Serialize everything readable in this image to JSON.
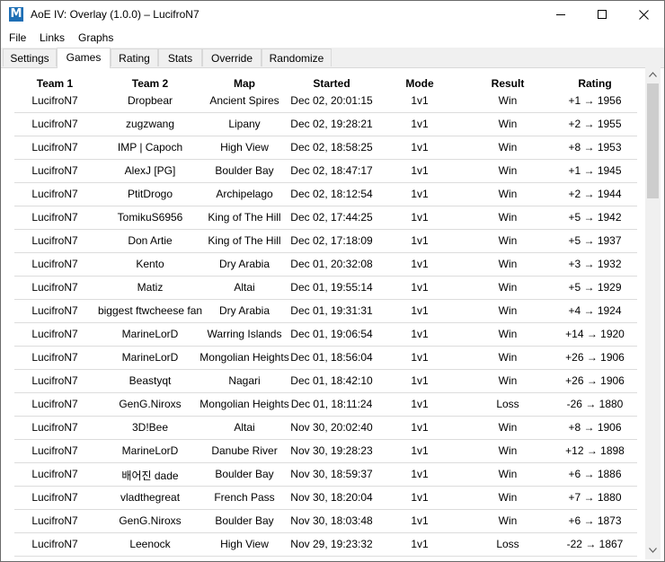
{
  "window": {
    "title": "AoE IV: Overlay (1.0.0) – LucifroN7",
    "icon_letter": "M"
  },
  "menu": [
    "File",
    "Links",
    "Graphs"
  ],
  "tabs": [
    "Settings",
    "Games",
    "Rating",
    "Stats",
    "Override",
    "Randomize"
  ],
  "active_tab": "Games",
  "table": {
    "columns": [
      "Team 1",
      "Team 2",
      "Map",
      "Started",
      "Mode",
      "Result",
      "Rating"
    ],
    "rows": [
      [
        "LucifroN7",
        "Dropbear",
        "Ancient Spires",
        "Dec 02, 20:01:15",
        "1v1",
        "Win",
        "+1 → 1956"
      ],
      [
        "LucifroN7",
        "zugzwang",
        "Lipany",
        "Dec 02, 19:28:21",
        "1v1",
        "Win",
        "+2 → 1955"
      ],
      [
        "LucifroN7",
        "IMP | Capoch",
        "High View",
        "Dec 02, 18:58:25",
        "1v1",
        "Win",
        "+8 → 1953"
      ],
      [
        "LucifroN7",
        "AlexJ [PG]",
        "Boulder Bay",
        "Dec 02, 18:47:17",
        "1v1",
        "Win",
        "+1 → 1945"
      ],
      [
        "LucifroN7",
        "PtitDrogo",
        "Archipelago",
        "Dec 02, 18:12:54",
        "1v1",
        "Win",
        "+2 → 1944"
      ],
      [
        "LucifroN7",
        "TomikuS6956",
        "King of The Hill",
        "Dec 02, 17:44:25",
        "1v1",
        "Win",
        "+5 → 1942"
      ],
      [
        "LucifroN7",
        "Don Artie",
        "King of The Hill",
        "Dec 02, 17:18:09",
        "1v1",
        "Win",
        "+5 → 1937"
      ],
      [
        "LucifroN7",
        "Kento",
        "Dry Arabia",
        "Dec 01, 20:32:08",
        "1v1",
        "Win",
        "+3 → 1932"
      ],
      [
        "LucifroN7",
        "Matiz",
        "Altai",
        "Dec 01, 19:55:14",
        "1v1",
        "Win",
        "+5 → 1929"
      ],
      [
        "LucifroN7",
        "biggest ftwcheese fan",
        "Dry Arabia",
        "Dec 01, 19:31:31",
        "1v1",
        "Win",
        "+4 → 1924"
      ],
      [
        "LucifroN7",
        "MarineLorD",
        "Warring Islands",
        "Dec 01, 19:06:54",
        "1v1",
        "Win",
        "+14 → 1920"
      ],
      [
        "LucifroN7",
        "MarineLorD",
        "Mongolian Heights",
        "Dec 01, 18:56:04",
        "1v1",
        "Win",
        "+26 → 1906"
      ],
      [
        "LucifroN7",
        "Beastyqt",
        "Nagari",
        "Dec 01, 18:42:10",
        "1v1",
        "Win",
        "+26 → 1906"
      ],
      [
        "LucifroN7",
        "GenG.Niroxs",
        "Mongolian Heights",
        "Dec 01, 18:11:24",
        "1v1",
        "Loss",
        "-26 → 1880"
      ],
      [
        "LucifroN7",
        "3D!Bee",
        "Altai",
        "Nov 30, 20:02:40",
        "1v1",
        "Win",
        "+8 → 1906"
      ],
      [
        "LucifroN7",
        "MarineLorD",
        "Danube River",
        "Nov 30, 19:28:23",
        "1v1",
        "Win",
        "+12 → 1898"
      ],
      [
        "LucifroN7",
        "배어진 dade",
        "Boulder Bay",
        "Nov 30, 18:59:37",
        "1v1",
        "Win",
        "+6 → 1886"
      ],
      [
        "LucifroN7",
        "vladthegreat",
        "French Pass",
        "Nov 30, 18:20:04",
        "1v1",
        "Win",
        "+7 → 1880"
      ],
      [
        "LucifroN7",
        "GenG.Niroxs",
        "Boulder Bay",
        "Nov 30, 18:03:48",
        "1v1",
        "Win",
        "+6 → 1873"
      ],
      [
        "LucifroN7",
        "Leenock",
        "High View",
        "Nov 29, 19:23:32",
        "1v1",
        "Loss",
        "-22 → 1867"
      ]
    ]
  },
  "icons": {
    "minimize": "minimize-icon",
    "maximize": "maximize-icon",
    "close": "close-icon",
    "scroll_up": "chevron-up-icon",
    "scroll_down": "chevron-down-icon"
  }
}
